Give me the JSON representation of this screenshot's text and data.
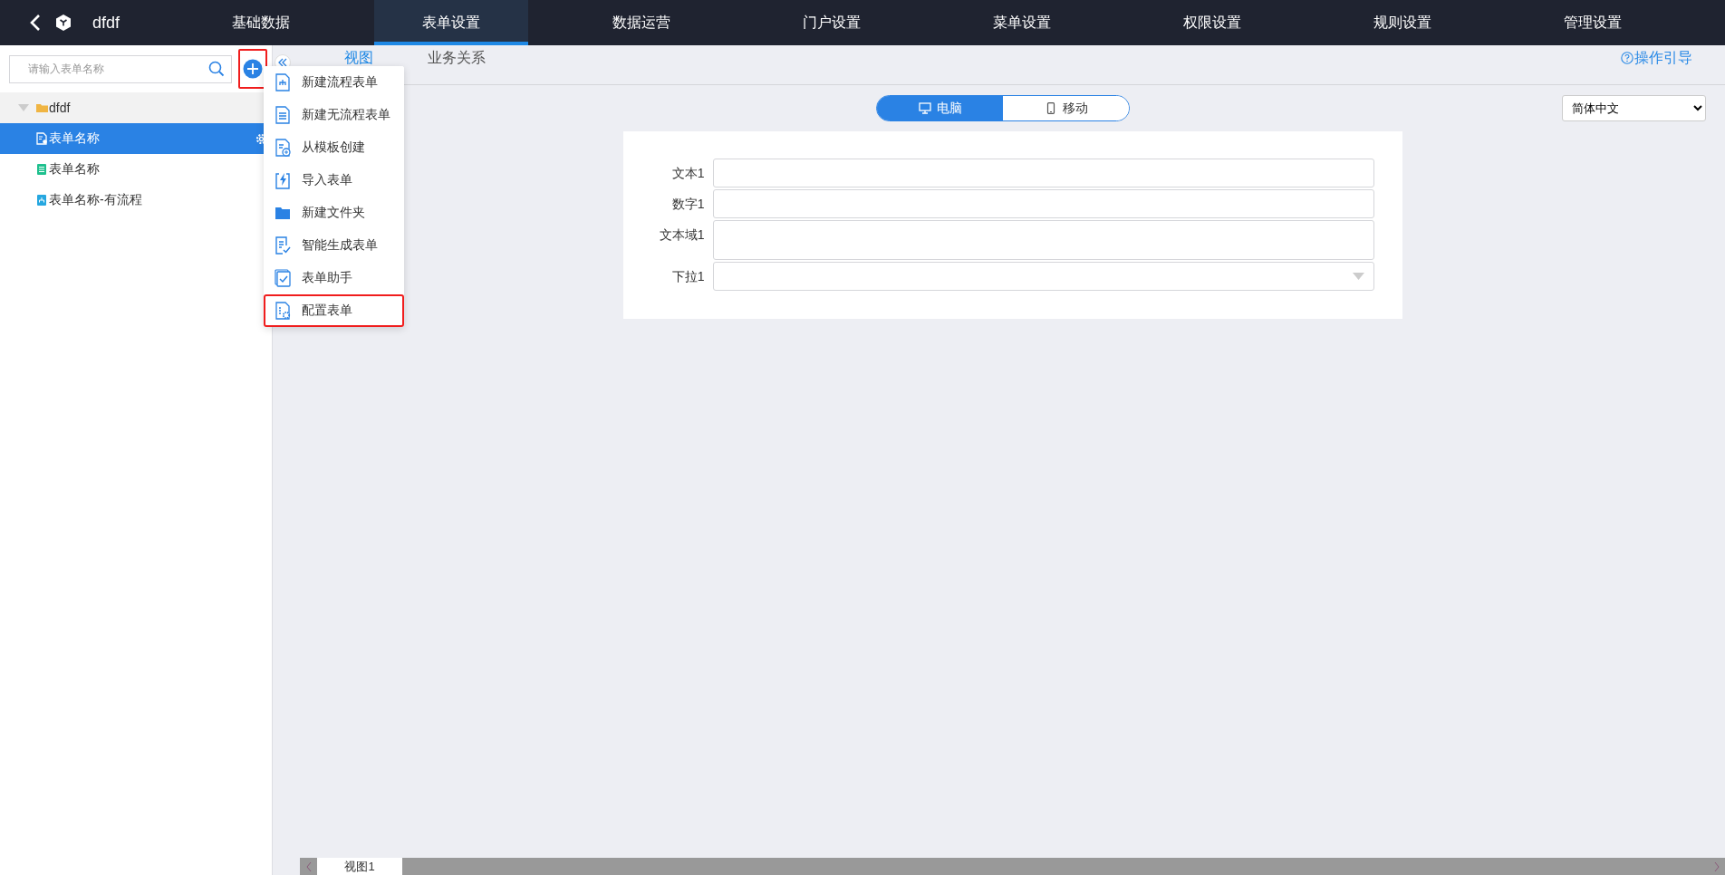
{
  "app": {
    "title": "dfdf"
  },
  "nav": [
    {
      "label": "基础数据",
      "selected": false
    },
    {
      "label": "表单设置",
      "selected": true
    },
    {
      "label": "数据运营",
      "selected": false
    },
    {
      "label": "门户设置",
      "selected": false
    },
    {
      "label": "菜单设置",
      "selected": false
    },
    {
      "label": "权限设置",
      "selected": false
    },
    {
      "label": "规则设置",
      "selected": false
    },
    {
      "label": "管理设置",
      "selected": false
    }
  ],
  "sidebar": {
    "search": {
      "placeholder": "请输入表单名称"
    },
    "add_button": {
      "highlighted": true
    },
    "tree": [
      {
        "label": "dfdf",
        "kind": "folder",
        "expanded": true,
        "selected": false,
        "children": [
          {
            "label": "表单名称",
            "kind": "config",
            "selected": true
          },
          {
            "label": "表单名称",
            "kind": "plain",
            "selected": false
          },
          {
            "label": "表单名称-有流程",
            "kind": "flow",
            "selected": false
          }
        ]
      }
    ]
  },
  "add_menu": [
    {
      "label": "新建流程表单",
      "kind": "flow",
      "highlighted": false
    },
    {
      "label": "新建无流程表单",
      "kind": "plain",
      "highlighted": false
    },
    {
      "label": "从模板创建",
      "kind": "template",
      "highlighted": false
    },
    {
      "label": "导入表单",
      "kind": "import",
      "highlighted": false
    },
    {
      "label": "新建文件夹",
      "kind": "folder",
      "highlighted": false
    },
    {
      "label": "智能生成表单",
      "kind": "ai",
      "highlighted": false
    },
    {
      "label": "表单助手",
      "kind": "assistant",
      "highlighted": false
    },
    {
      "label": "配置表单",
      "kind": "config",
      "highlighted": true
    }
  ],
  "tabs": [
    {
      "label": "视图",
      "selected": true
    },
    {
      "label": "业务关系",
      "selected": false
    }
  ],
  "guide_link": "操作引导",
  "device_toggle": [
    {
      "label": "电脑",
      "kind": "desktop",
      "selected": true
    },
    {
      "label": "移动",
      "kind": "mobile",
      "selected": false
    }
  ],
  "language": {
    "value": "简体中文"
  },
  "form": {
    "fields": [
      {
        "label": "文本1",
        "kind": "text"
      },
      {
        "label": "数字1",
        "kind": "text"
      },
      {
        "label": "文本域1",
        "kind": "textarea"
      },
      {
        "label": "下拉1",
        "kind": "select"
      }
    ]
  },
  "view_tabs": [
    {
      "label": "视图1",
      "selected": true
    }
  ]
}
